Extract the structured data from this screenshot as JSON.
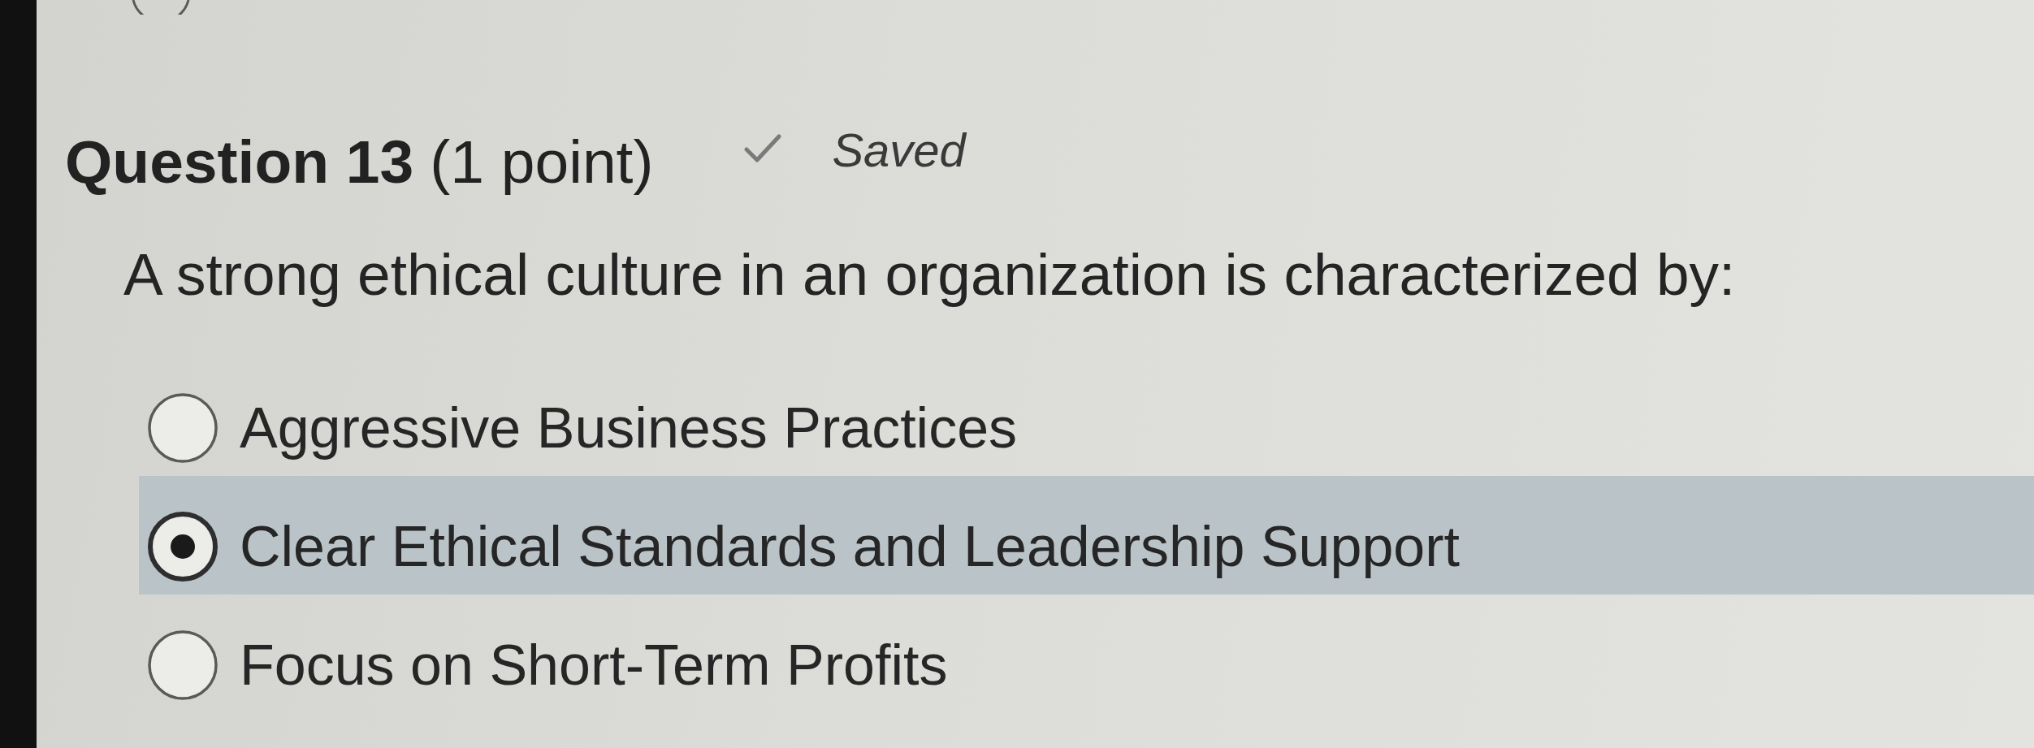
{
  "question": {
    "title": "Question 13",
    "points": "(1 point)",
    "status": "Saved"
  },
  "prompt": "A strong ethical culture in an organization is characterized by:",
  "options": [
    {
      "label": "Aggressive Business Practices",
      "selected": false
    },
    {
      "label": "Clear Ethical Standards and Leadership Support",
      "selected": true
    },
    {
      "label": "Focus on Short-Term Profits",
      "selected": false
    }
  ]
}
